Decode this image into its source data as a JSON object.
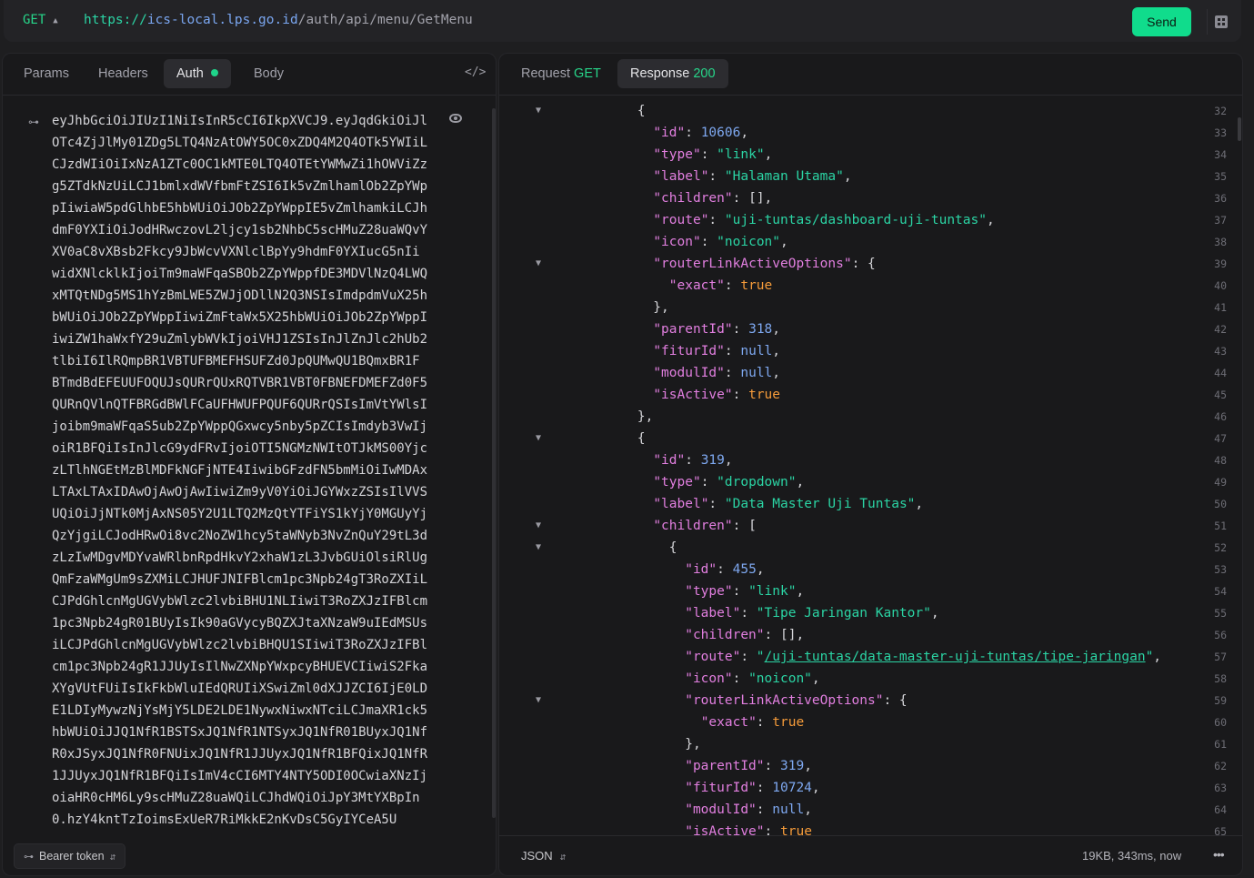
{
  "request": {
    "method": "GET",
    "url_proto": "https://",
    "url_host": "ics-local.lps.go.id",
    "url_path": "/auth/api/menu/GetMenu",
    "send_label": "Send"
  },
  "left_tabs": {
    "params": "Params",
    "headers": "Headers",
    "auth": "Auth",
    "body": "Body",
    "code_icon": "</>"
  },
  "token_lines": [
    "eyJhbGciOiJIUzI1NiIsInR5cCI6IkpXVCJ9.eyJqdGkiOiJl",
    "OTc4ZjJlMy01ZDg5LTQ4NzAtOWY5OC0xZDQ4M2Q4OTk5YWIiL",
    "CJzdWIiOiIxNzA1ZTc0OC1kMTE0LTQ4OTEtYWMwZi1hOWViZz",
    "g5ZTdkNzUiLCJ1bmlxdWVfbmFtZSI6Ik5vZmlhamlOb2ZpYWp",
    "pIiwiaW5pdGlhbE5hbWUiOiJOb2ZpYWppIE5vZmlhamkiLCJh",
    "dmF0YXIiOiJodHRwczovL2ljcy1sb2NhbC5scHMuZ28uaWQvY",
    "XV0aC8vXBsb2Fkcy9JbWcvVXNlclBpYy9hdmF0YXIucG5nIi",
    "widXNlcklkIjoiTm9maWFqaSBOb2ZpYWppfDE3MDVlNzQ4LWQ",
    "xMTQtNDg5MS1hYzBmLWE5ZWJjODllN2Q3NSIsImdpdmVuX25h",
    "bWUiOiJOb2ZpYWppIiwiZmFtaWx5X25hbWUiOiJOb2ZpYWppI",
    "iwiZW1haWxfY29uZmlybWVkIjoiVHJ1ZSIsInJlZnJlc2hUb2",
    "tlbiI6IlRQmpBR1VBTUFBMEFHSUFZd0JpQUMwQU1BQmxBR1F",
    "BTmdBdEFEUUFOQUJsQURrQUxRQTVBR1VBT0FBNEFDMEFZd0F5",
    "QURnQVlnQTFBRGdBWlFCaUFHWUFPQUF6QURrQSIsImVtYWlsI",
    "joibm9maWFqaS5ub2ZpYWppQGxwcy5nby5pZCIsImdyb3VwIj",
    "oiR1BFQiIsInJlcG9ydFRvIjoiOTI5NGMzNWItOTJkMS00Yjc",
    "zLTlhNGEtMzBlMDFkNGFjNTE4IiwibGFzdFN5bmMiOiIwMDAx",
    "LTAxLTAxIDAwOjAwOjAwIiwiZm9yV0YiOiJGYWxzZSIsIlVVS",
    "UQiOiJjNTk0MjAxNS05Y2U1LTQ2MzQtYTFiYS1kYjY0MGUyYj",
    "QzYjgiLCJodHRwOi8vc2NoZW1hcy5taWNyb3NvZnQuY29tL3d",
    "zLzIwMDgvMDYvaWRlbnRpdHkvY2xhaW1zL3JvbGUiOlsiRlUg",
    "QmFzaWMgUm9sZXMiLCJHUFJNIFBlcm1pc3Npb24gT3RoZXIiL",
    "CJPdGhlcnMgUGVybWlzc2lvbiBHU1NLIiwiT3RoZXJzIFBlcm",
    "1pc3Npb24gR01BUyIsIk90aGVycyBQZXJtaXNzaW9uIEdMSUs",
    "iLCJPdGhlcnMgUGVybWlzc2lvbiBHQU1SIiwiT3RoZXJzIFBl",
    "cm1pc3Npb24gR1JJUyIsIlNwZXNpYWxpcyBHUEVCIiwiS2Fka",
    "XYgVUtFUiIsIkFkbWluIEdQRUIiXSwiZml0dXJJZCI6IjE0LD",
    "E1LDIyMywzNjYsMjY5LDE2LDE1NywxNiwxNTciLCJmaXR1ck5",
    "hbWUiOiJJQ1NfR1BSTSxJQ1NfR1NTSyxJQ1NfR01BUyxJQ1Nf",
    "R0xJSyxJQ1NfR0FNUixJQ1NfR1JJUyxJQ1NfR1BFQixJQ1NfR",
    "1JJUyxJQ1NfR1BFQiIsImV4cCI6MTY4NTY5ODI0OCwiaXNzIj",
    "oiaHR0cHM6Ly9scHMuZ28uaWQiLCJhdWQiOiJpY3MtYXBpIn",
    "0.hzY4kntTzIoimsExUeR7RiMkkE2nKvDsC5GyIYCeA5U"
  ],
  "bearer": {
    "label": "Bearer token"
  },
  "right_tabs": {
    "request_label": "Request",
    "request_method": "GET",
    "response_label": "Response",
    "response_status": "200"
  },
  "response_lines": [
    {
      "ln": "32",
      "fold": true,
      "html": "        {"
    },
    {
      "ln": "33",
      "html": "          <span class=\"k\">\"id\"</span>: <span class=\"n\">10606</span>,"
    },
    {
      "ln": "34",
      "html": "          <span class=\"k\">\"type\"</span>: <span class=\"s\">\"link\"</span>,"
    },
    {
      "ln": "35",
      "html": "          <span class=\"k\">\"label\"</span>: <span class=\"s\">\"Halaman Utama\"</span>,"
    },
    {
      "ln": "36",
      "html": "          <span class=\"k\">\"children\"</span>: [],"
    },
    {
      "ln": "37",
      "html": "          <span class=\"k\">\"route\"</span>: <span class=\"s\">\"uji-tuntas/dashboard-uji-tuntas\"</span>,"
    },
    {
      "ln": "38",
      "html": "          <span class=\"k\">\"icon\"</span>: <span class=\"s\">\"noicon\"</span>,"
    },
    {
      "ln": "39",
      "fold": true,
      "html": "          <span class=\"k\">\"routerLinkActiveOptions\"</span>: {"
    },
    {
      "ln": "40",
      "html": "            <span class=\"k\">\"exact\"</span>: <span class=\"t\">true</span>"
    },
    {
      "ln": "41",
      "html": "          },"
    },
    {
      "ln": "42",
      "html": "          <span class=\"k\">\"parentId\"</span>: <span class=\"n\">318</span>,"
    },
    {
      "ln": "43",
      "html": "          <span class=\"k\">\"fiturId\"</span>: <span class=\"n\">null</span>,"
    },
    {
      "ln": "44",
      "html": "          <span class=\"k\">\"modulId\"</span>: <span class=\"n\">null</span>,"
    },
    {
      "ln": "45",
      "html": "          <span class=\"k\">\"isActive\"</span>: <span class=\"t\">true</span>"
    },
    {
      "ln": "46",
      "html": "        },"
    },
    {
      "ln": "47",
      "fold": true,
      "html": "        {"
    },
    {
      "ln": "48",
      "html": "          <span class=\"k\">\"id\"</span>: <span class=\"n\">319</span>,"
    },
    {
      "ln": "49",
      "html": "          <span class=\"k\">\"type\"</span>: <span class=\"s\">\"dropdown\"</span>,"
    },
    {
      "ln": "50",
      "html": "          <span class=\"k\">\"label\"</span>: <span class=\"s\">\"Data Master Uji Tuntas\"</span>,"
    },
    {
      "ln": "51",
      "fold": true,
      "html": "          <span class=\"k\">\"children\"</span>: ["
    },
    {
      "ln": "52",
      "fold": true,
      "html": "            {"
    },
    {
      "ln": "53",
      "html": "              <span class=\"k\">\"id\"</span>: <span class=\"n\">455</span>,"
    },
    {
      "ln": "54",
      "html": "              <span class=\"k\">\"type\"</span>: <span class=\"s\">\"link\"</span>,"
    },
    {
      "ln": "55",
      "html": "              <span class=\"k\">\"label\"</span>: <span class=\"s\">\"Tipe Jaringan Kantor\"</span>,"
    },
    {
      "ln": "56",
      "html": "              <span class=\"k\">\"children\"</span>: [],"
    },
    {
      "ln": "57",
      "html": "              <span class=\"k\">\"route\"</span>: <span class=\"s\">\"<u>/uji-tuntas/data-master-uji-tuntas/tipe-jaringan</u>\"</span>,"
    },
    {
      "ln": "58",
      "html": "              <span class=\"k\">\"icon\"</span>: <span class=\"s\">\"noicon\"</span>,"
    },
    {
      "ln": "59",
      "fold": true,
      "html": "              <span class=\"k\">\"routerLinkActiveOptions\"</span>: {"
    },
    {
      "ln": "60",
      "html": "                <span class=\"k\">\"exact\"</span>: <span class=\"t\">true</span>"
    },
    {
      "ln": "61",
      "html": "              },"
    },
    {
      "ln": "62",
      "html": "              <span class=\"k\">\"parentId\"</span>: <span class=\"n\">319</span>,"
    },
    {
      "ln": "63",
      "html": "              <span class=\"k\">\"fiturId\"</span>: <span class=\"n\">10724</span>,"
    },
    {
      "ln": "64",
      "html": "              <span class=\"k\">\"modulId\"</span>: <span class=\"n\">null</span>,"
    },
    {
      "ln": "65",
      "html": "              <span class=\"k\">\"isActive\"</span>: <span class=\"t\">true</span>"
    }
  ],
  "footer": {
    "format": "JSON",
    "stats": "19KB, 343ms, now",
    "more": "•••"
  }
}
